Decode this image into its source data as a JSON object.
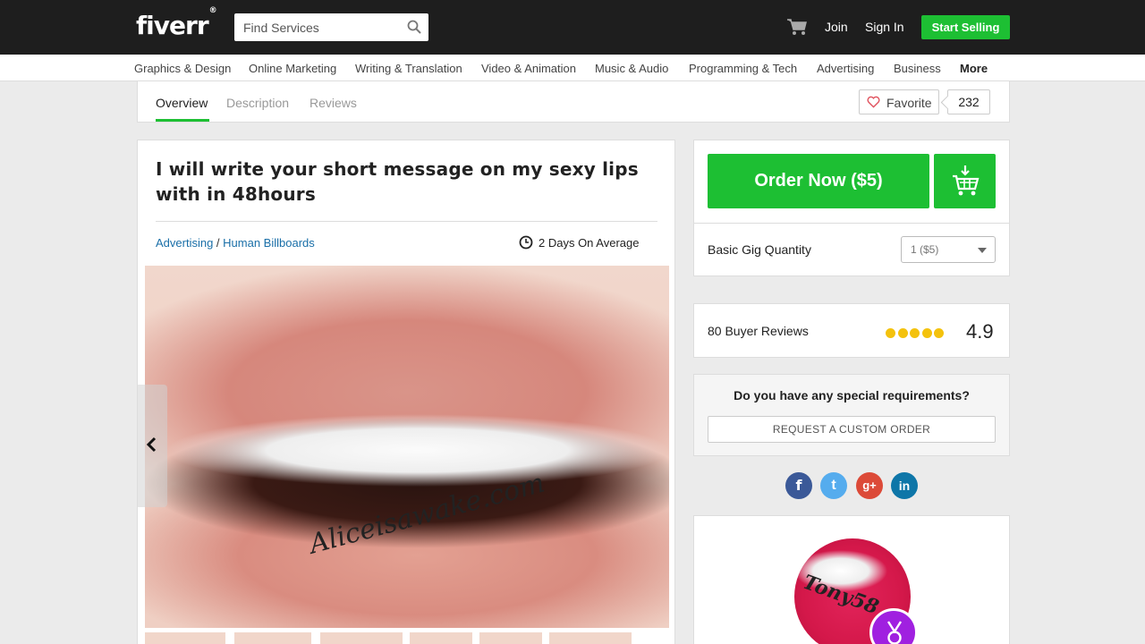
{
  "header": {
    "logo": "fiverr",
    "logo_mark": "®",
    "search_placeholder": "Find Services",
    "join": "Join",
    "sign_in": "Sign In",
    "start_selling": "Start Selling"
  },
  "categories": [
    "Graphics & Design",
    "Online Marketing",
    "Writing & Translation",
    "Video & Animation",
    "Music & Audio",
    "Programming & Tech",
    "Advertising",
    "Business",
    "More"
  ],
  "tabs": {
    "overview": "Overview",
    "description": "Description",
    "reviews": "Reviews",
    "favorite_label": "Favorite",
    "favorite_count": "232"
  },
  "gig": {
    "title": "I will write your short message on my sexy lips with in 48hours",
    "category": "Advertising",
    "separator": " / ",
    "subcategory": "Human Billboards",
    "delivery": "2 Days On Average",
    "image_text": "Aliceisawake.com"
  },
  "order": {
    "button_label": "Order Now ($5)",
    "quantity_label": "Basic Gig Quantity",
    "quantity_value": "1 ($5)"
  },
  "reviews": {
    "label": "80 Buyer Reviews",
    "rating": "4.9",
    "stars": 5
  },
  "custom": {
    "question": "Do you have any special requirements?",
    "button": "REQUEST A CUSTOM ORDER"
  },
  "social": [
    "f",
    "t",
    "g+",
    "in"
  ],
  "seller": {
    "avatar_text": "Tony58"
  },
  "colors": {
    "brand_green": "#1dbf33",
    "header_bg": "#1e1e1e",
    "link_blue": "#1a6fa8",
    "star_yellow": "#f4c20d"
  }
}
